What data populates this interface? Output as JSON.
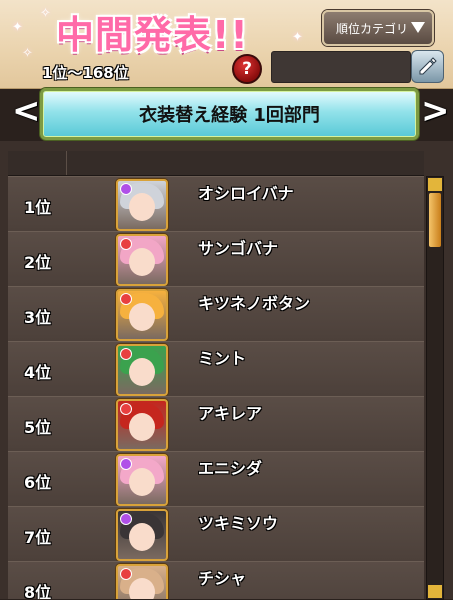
{
  "header": {
    "title": "中間発表!!",
    "range_text": "1位〜168位",
    "help_label": "?",
    "category_button_label": "順位カテゴリ",
    "player_name_value": ""
  },
  "banner": {
    "title": "衣装替え経験  1回部門",
    "prev_arrow": "<",
    "next_arrow": ">"
  },
  "ranking": {
    "rows": [
      {
        "rank": "1位",
        "name": "オシロイバナ",
        "hair_color": "#cfd3da",
        "gem_color": "#b050e8"
      },
      {
        "rank": "2位",
        "name": "サンゴバナ",
        "hair_color": "#f2a6c6",
        "gem_color": "#e84040"
      },
      {
        "rank": "3位",
        "name": "キツネノボタン",
        "hair_color": "#f6b13e",
        "gem_color": "#e84040"
      },
      {
        "rank": "4位",
        "name": "ミント",
        "hair_color": "#3ba24e",
        "gem_color": "#e84040"
      },
      {
        "rank": "5位",
        "name": "アキレア",
        "hair_color": "#c5261e",
        "gem_color": "#e84040"
      },
      {
        "rank": "6位",
        "name": "エニシダ",
        "hair_color": "#f3a8c9",
        "gem_color": "#b050e8"
      },
      {
        "rank": "7位",
        "name": "ツキミソウ",
        "hair_color": "#3a3536",
        "gem_color": "#b050e8"
      },
      {
        "rank": "8位",
        "name": "チシャ",
        "hair_color": "#d9b08a",
        "gem_color": "#e84040"
      }
    ]
  },
  "colors": {
    "title_pink": "#ff6aa8",
    "banner_cyan": "#92e2ea",
    "banner_border": "#7d9b43",
    "row_bg": "#5a4d46",
    "scroll_accent": "#e3b53a"
  }
}
